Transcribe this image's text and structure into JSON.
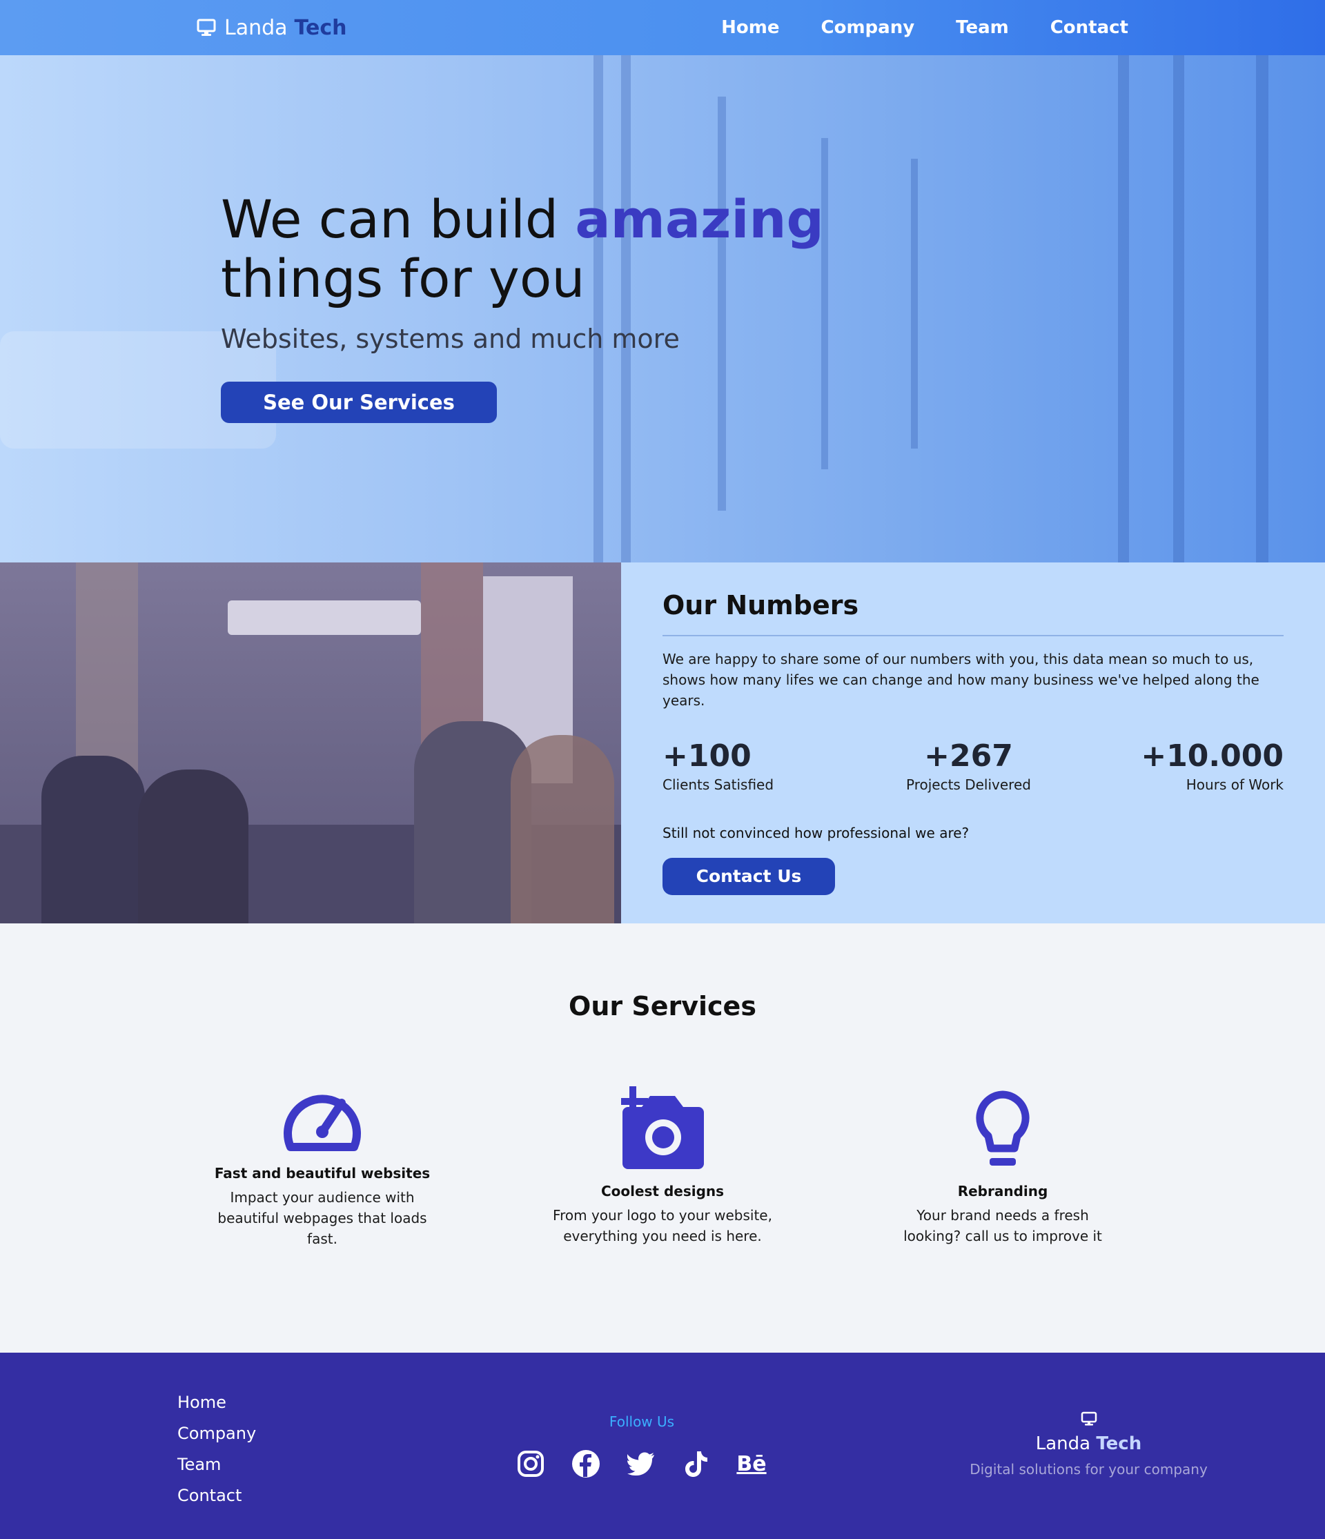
{
  "brand": {
    "name_light": "Landa",
    "name_bold": "Tech",
    "icon": "monitor-icon"
  },
  "nav": {
    "links": [
      "Home",
      "Company",
      "Team",
      "Contact"
    ]
  },
  "hero": {
    "title_part1": "We can build ",
    "title_highlight": "amazing",
    "title_part2": "things for you",
    "subtitle": "Websites, systems and much more",
    "cta": "See Our Services"
  },
  "numbers": {
    "title": "Our Numbers",
    "text": "We are happy to share some of our numbers with you, this data mean so much to us, shows how many lifes we can change and how many business we've helped along the years.",
    "stats": [
      {
        "value": "+100",
        "label": "Clients Satisfied"
      },
      {
        "value": "+267",
        "label": "Projects Delivered"
      },
      {
        "value": "+10.000",
        "label": "Hours of Work"
      }
    ],
    "question": "Still not convinced how professional we are?",
    "cta": "Contact Us"
  },
  "services": {
    "title": "Our Services",
    "items": [
      {
        "icon": "speedometer-icon",
        "title": "Fast and beautiful websites",
        "text": "Impact your audience with beautiful webpages that loads fast."
      },
      {
        "icon": "add-camera-icon",
        "title": "Coolest designs",
        "text": "From your logo to your website, everything you need is here."
      },
      {
        "icon": "lightbulb-icon",
        "title": "Rebranding",
        "text": "Your brand needs a fresh looking? call us to improve it"
      }
    ]
  },
  "footer": {
    "links": [
      "Home",
      "Company",
      "Team",
      "Contact"
    ],
    "follow_label": "Follow Us",
    "socials": [
      "instagram-icon",
      "facebook-icon",
      "twitter-icon",
      "tiktok-icon",
      "behance-icon"
    ],
    "behance_text": "Bē",
    "brand_light": "Landa",
    "brand_bold": "Tech",
    "tagline": "Digital solutions for your company"
  },
  "colors": {
    "accent": "#3a3bc2",
    "button": "#2343b7",
    "footer": "#342ea3",
    "nav": "#4a8ff0",
    "panel": "#bfdbfd"
  }
}
